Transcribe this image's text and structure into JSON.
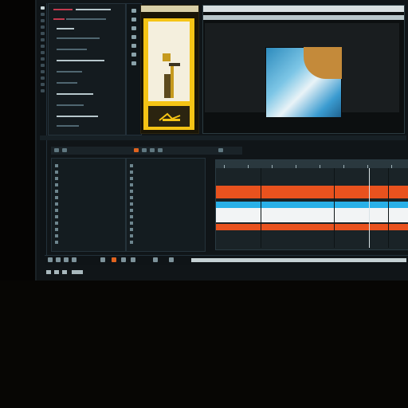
{
  "inspector": {
    "rows": [
      "",
      "",
      "",
      "",
      "",
      ""
    ]
  },
  "monitors": {
    "source_label": "",
    "program_label": ""
  },
  "panel_header": {
    "items": [
      "",
      "",
      "",
      "",
      ""
    ]
  },
  "bins": {
    "left_rows": [
      "",
      "",
      "",
      "",
      "",
      "",
      "",
      "",
      "",
      "",
      "",
      "",
      "",
      ""
    ],
    "mid_rows": [
      "",
      "",
      "",
      "",
      "",
      "",
      "",
      "",
      "",
      "",
      "",
      "",
      "",
      ""
    ]
  },
  "timeline": {
    "tracks": [
      "orange",
      "blue",
      "white",
      "orange"
    ]
  },
  "transport": {
    "buttons": [
      "",
      "",
      "",
      "",
      "",
      "",
      "",
      "",
      "",
      ""
    ]
  },
  "colors": {
    "accent_orange": "#e9521e",
    "accent_blue": "#29b0e8",
    "accent_yellow": "#f5c415",
    "accent_pink": "#c33a4e",
    "panel_bg": "#141c20"
  },
  "icons": [
    "tool-icon",
    "play-icon",
    "stop-icon",
    "step-icon",
    "marker-icon",
    "settings-icon"
  ]
}
